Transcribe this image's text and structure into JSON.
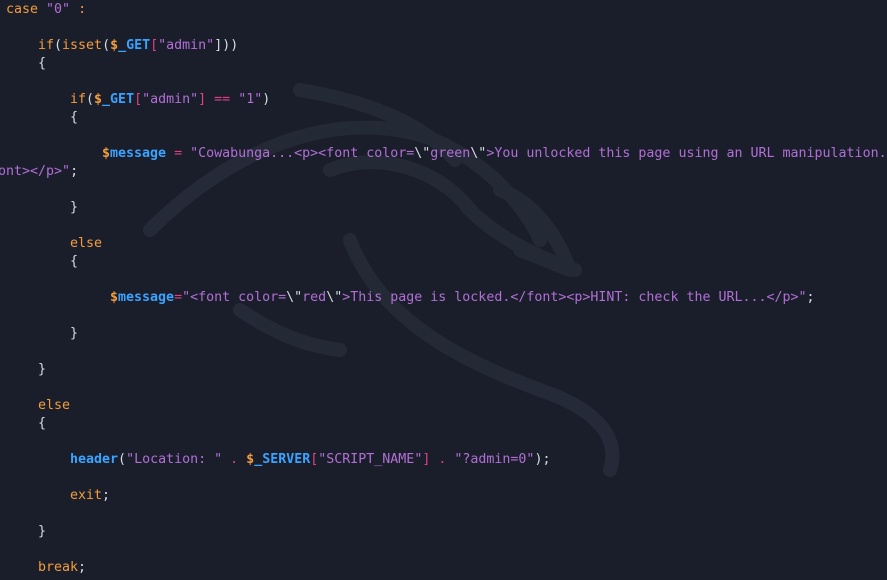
{
  "lines": [
    {
      "id": "case",
      "segments": [
        {
          "t": "case ",
          "c": "kw"
        },
        {
          "t": "\"0\"",
          "c": "str"
        },
        {
          "t": " :",
          "c": "kw"
        }
      ]
    },
    {
      "id": "if-isset",
      "segments": [
        {
          "t": "if",
          "c": "kw"
        },
        {
          "t": "(",
          "c": "punc"
        },
        {
          "t": "isset",
          "c": "kw"
        },
        {
          "t": "(",
          "c": "punc"
        },
        {
          "t": "$",
          "c": "dollar"
        },
        {
          "t": "_GET",
          "c": "var"
        },
        {
          "t": "[",
          "c": "op"
        },
        {
          "t": "\"admin\"",
          "c": "str"
        },
        {
          "t": "]))",
          "c": "punc"
        }
      ]
    },
    {
      "id": "brace-1",
      "segments": [
        {
          "t": "{",
          "c": "punc"
        }
      ]
    },
    {
      "id": "if-admin",
      "segments": [
        {
          "t": "if",
          "c": "kw"
        },
        {
          "t": "(",
          "c": "punc"
        },
        {
          "t": "$",
          "c": "dollar"
        },
        {
          "t": "_GET",
          "c": "var"
        },
        {
          "t": "[",
          "c": "op"
        },
        {
          "t": "\"admin\"",
          "c": "str"
        },
        {
          "t": "]",
          "c": "op"
        },
        {
          "t": " == ",
          "c": "op"
        },
        {
          "t": "\"1\"",
          "c": "str"
        },
        {
          "t": ")",
          "c": "punc"
        }
      ]
    },
    {
      "id": "brace-2",
      "segments": [
        {
          "t": "{",
          "c": "punc"
        }
      ]
    },
    {
      "id": "msg-green-a",
      "segments": [
        {
          "t": "$",
          "c": "dollar"
        },
        {
          "t": "message",
          "c": "var"
        },
        {
          "t": " = ",
          "c": "op"
        },
        {
          "t": "\"Cowabunga...<p><font color=",
          "c": "str"
        },
        {
          "t": "\\\"",
          "c": "punc"
        },
        {
          "t": "green",
          "c": "str"
        },
        {
          "t": "\\\"",
          "c": "punc"
        },
        {
          "t": ">You unlocked this page using an URL manipulation.</",
          "c": "str"
        }
      ]
    },
    {
      "id": "msg-green-b",
      "segments": [
        {
          "t": "ont></p>\"",
          "c": "str"
        },
        {
          "t": ";",
          "c": "punc"
        }
      ]
    },
    {
      "id": "brace-3",
      "segments": [
        {
          "t": "}",
          "c": "punc"
        }
      ]
    },
    {
      "id": "else-1",
      "segments": [
        {
          "t": "else",
          "c": "kw"
        }
      ]
    },
    {
      "id": "brace-4",
      "segments": [
        {
          "t": "{",
          "c": "punc"
        }
      ]
    },
    {
      "id": "msg-red",
      "segments": [
        {
          "t": "$",
          "c": "dollar"
        },
        {
          "t": "message",
          "c": "var"
        },
        {
          "t": "=",
          "c": "op"
        },
        {
          "t": "\"<font color=",
          "c": "str"
        },
        {
          "t": "\\\"",
          "c": "punc"
        },
        {
          "t": "red",
          "c": "str"
        },
        {
          "t": "\\\"",
          "c": "punc"
        },
        {
          "t": ">This page is locked.</font><p>HINT: check the URL...</p>\"",
          "c": "str"
        },
        {
          "t": ";",
          "c": "punc"
        }
      ]
    },
    {
      "id": "brace-5",
      "segments": [
        {
          "t": "}",
          "c": "punc"
        }
      ]
    },
    {
      "id": "brace-6",
      "segments": [
        {
          "t": "}",
          "c": "punc"
        }
      ]
    },
    {
      "id": "else-2",
      "segments": [
        {
          "t": "else",
          "c": "kw"
        }
      ]
    },
    {
      "id": "brace-7",
      "segments": [
        {
          "t": "{",
          "c": "punc"
        }
      ]
    },
    {
      "id": "header",
      "segments": [
        {
          "t": "header",
          "c": "fn"
        },
        {
          "t": "(",
          "c": "punc"
        },
        {
          "t": "\"Location: \"",
          "c": "str"
        },
        {
          "t": " . ",
          "c": "op"
        },
        {
          "t": "$",
          "c": "dollar"
        },
        {
          "t": "_SERVER",
          "c": "var"
        },
        {
          "t": "[",
          "c": "op"
        },
        {
          "t": "\"SCRIPT_NAME\"",
          "c": "str"
        },
        {
          "t": "]",
          "c": "op"
        },
        {
          "t": " . ",
          "c": "op"
        },
        {
          "t": "\"?admin=0\"",
          "c": "str"
        },
        {
          "t": ");",
          "c": "punc"
        }
      ]
    },
    {
      "id": "exit",
      "segments": [
        {
          "t": "exit",
          "c": "kw"
        },
        {
          "t": ";",
          "c": "punc"
        }
      ]
    },
    {
      "id": "brace-8",
      "segments": [
        {
          "t": "}",
          "c": "punc"
        }
      ]
    },
    {
      "id": "break",
      "segments": [
        {
          "t": "break",
          "c": "kw"
        },
        {
          "t": ";",
          "c": "punc"
        }
      ]
    }
  ]
}
